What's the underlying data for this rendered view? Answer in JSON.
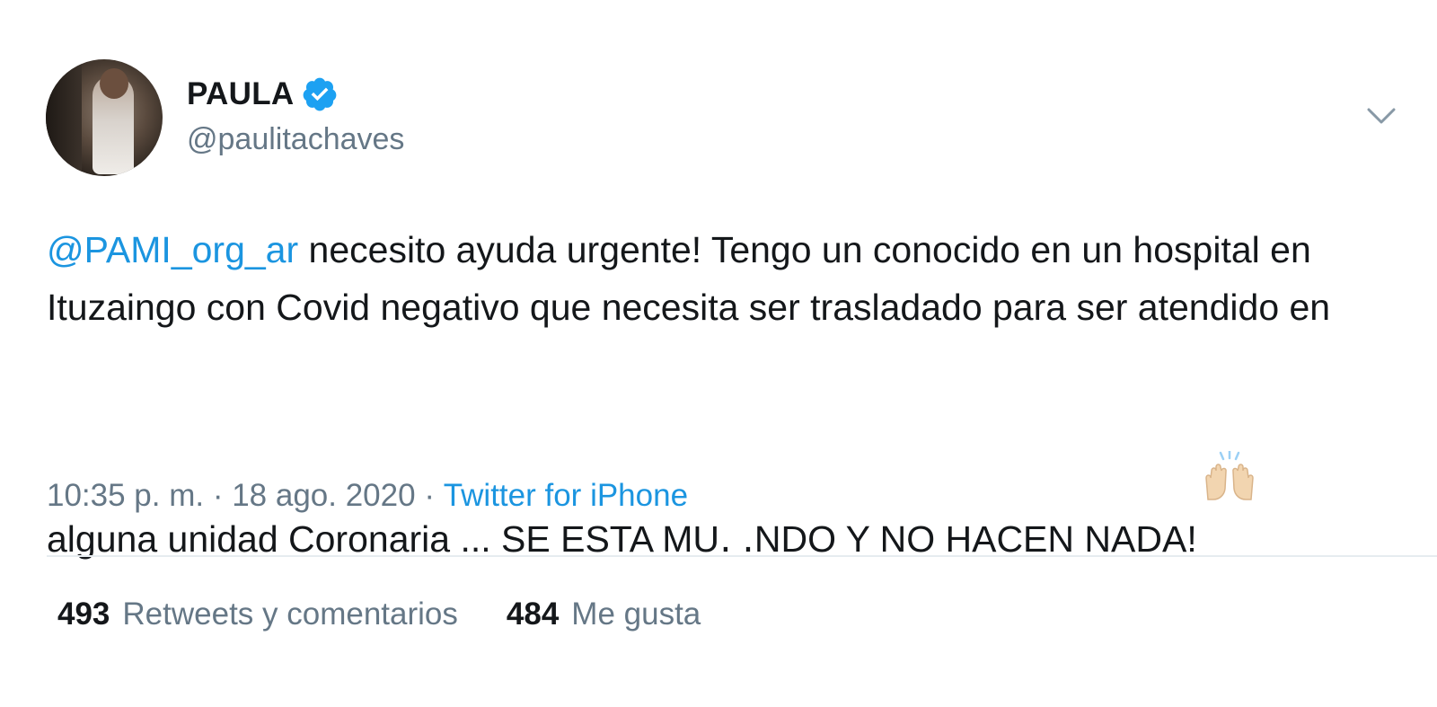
{
  "author": {
    "display_name": "PAULA",
    "handle": "@paulitachaves",
    "verified_icon": "verified-badge-icon"
  },
  "tweet": {
    "mention": "@PAMI_org_ar",
    "text": " necesito ayuda urgente! Tengo un conocido en un hospital en Ituzaingo con Covid negativo que necesita ser trasladado para ser atendido en alguna unidad Coronaria ... SE ESTA MU․ ․NDO Y NO HACEN NADA!",
    "emoji": "raising-hands-emoji"
  },
  "meta": {
    "time": "10:35 p. m.",
    "separator": " · ",
    "date": "18 ago. 2020",
    "separator2": " · ",
    "source": "Twitter for iPhone"
  },
  "stats": {
    "retweets_count": "493",
    "retweets_label": "Retweets y comentarios",
    "likes_count": "484",
    "likes_label": "Me gusta"
  },
  "colors": {
    "link": "#1b95e0",
    "secondary_text": "#657786",
    "primary_text": "#14171a",
    "verified": "#1da1f2"
  }
}
